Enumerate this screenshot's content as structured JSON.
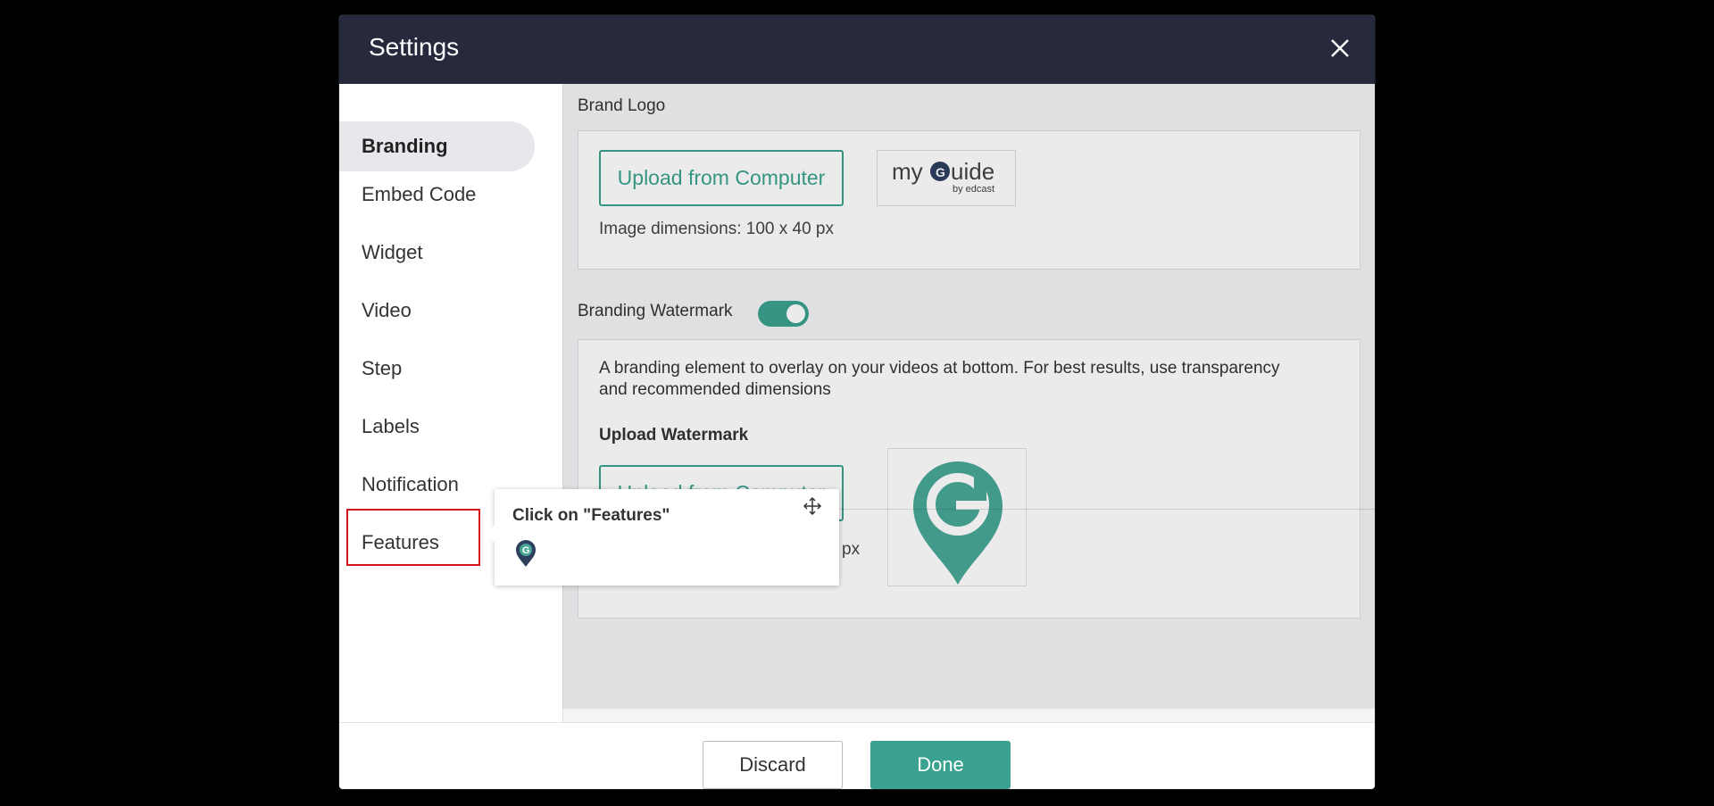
{
  "dialog": {
    "title": "Settings",
    "close_icon": "close-icon"
  },
  "sidebar": {
    "items": [
      {
        "label": "Branding",
        "active": true
      },
      {
        "label": "Embed Code",
        "active": false
      },
      {
        "label": "Widget",
        "active": false
      },
      {
        "label": "Video",
        "active": false
      },
      {
        "label": "Step",
        "active": false
      },
      {
        "label": "Labels",
        "active": false
      },
      {
        "label": "Notification",
        "active": false
      },
      {
        "label": "Features",
        "active": false
      }
    ]
  },
  "brand_logo": {
    "label": "Brand Logo",
    "upload_label": "Upload from Computer",
    "dimensions_hint": "Image dimensions: 100 x 40 px",
    "logo_text": "myGuide",
    "logo_sub": "by edcast"
  },
  "watermark": {
    "label": "Branding Watermark",
    "toggle_on": true,
    "description_line1": "A branding element to overlay on your videos at bottom. For best results, use transparency",
    "description_line2": "and recommended dimensions",
    "upload_heading": "Upload Watermark",
    "upload_label": "Upload from Computer",
    "dimensions_hint_visible": "px"
  },
  "footer": {
    "discard_label": "Discard",
    "done_label": "Done"
  },
  "tooltip": {
    "title": "Click on \"Features\"",
    "move_icon": "move-icon",
    "logo_icon": "myguide-pin-icon"
  },
  "colors": {
    "header_bg": "#272a3d",
    "accent": "#3aa28e",
    "highlight": "#d3141b"
  }
}
